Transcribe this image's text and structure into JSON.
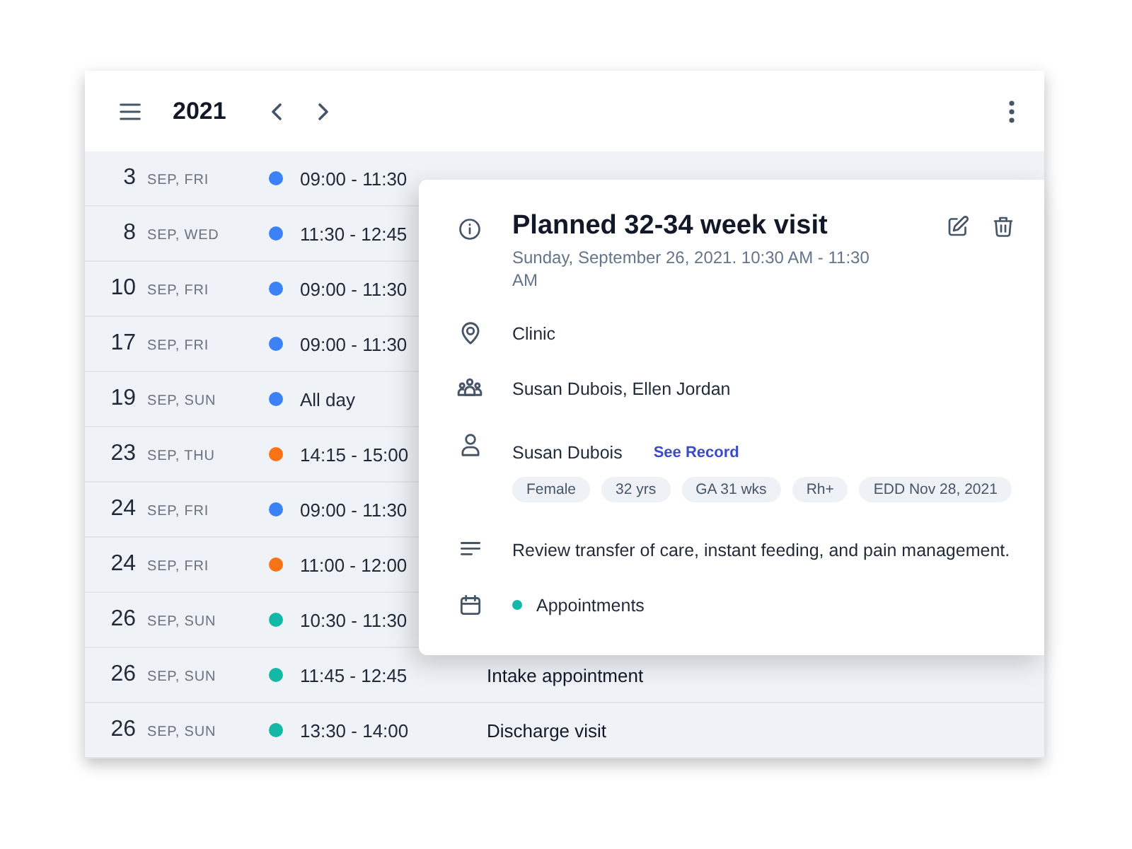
{
  "header": {
    "year": "2021"
  },
  "events": [
    {
      "day": "3",
      "date": "SEP, FRI",
      "color": "#3b82f6",
      "time": "09:00 - 11:30"
    },
    {
      "day": "8",
      "date": "SEP, WED",
      "color": "#3b82f6",
      "time": "11:30 - 12:45"
    },
    {
      "day": "10",
      "date": "SEP, FRI",
      "color": "#3b82f6",
      "time": "09:00 - 11:30"
    },
    {
      "day": "17",
      "date": "SEP, FRI",
      "color": "#3b82f6",
      "time": "09:00 - 11:30"
    },
    {
      "day": "19",
      "date": "SEP, SUN",
      "color": "#3b82f6",
      "time": "All day"
    },
    {
      "day": "23",
      "date": "SEP, THU",
      "color": "#f97316",
      "time": "14:15 - 15:00"
    },
    {
      "day": "24",
      "date": "SEP, FRI",
      "color": "#3b82f6",
      "time": "09:00 - 11:30"
    },
    {
      "day": "24",
      "date": "SEP, FRI",
      "color": "#f97316",
      "time": "11:00 - 12:00"
    },
    {
      "day": "26",
      "date": "SEP, SUN",
      "color": "#14b8a6",
      "time": "10:30 - 11:30"
    },
    {
      "day": "26",
      "date": "SEP, SUN",
      "color": "#14b8a6",
      "time": "11:45 - 12:45",
      "title": "Intake appointment"
    },
    {
      "day": "26",
      "date": "SEP, SUN",
      "color": "#14b8a6",
      "time": "13:30 - 14:00",
      "title": "Discharge visit"
    }
  ],
  "detail": {
    "title": "Planned 32-34 week visit",
    "when": "Sunday, September 26, 2021. 10:30 AM - 11:30 AM",
    "location": "Clinic",
    "attendees": "Susan Dubois, Ellen Jordan",
    "patient": {
      "name": "Susan Dubois",
      "link": "See Record",
      "tags": [
        "Female",
        "32 yrs",
        "GA 31 wks",
        "Rh+",
        "EDD Nov 28, 2021"
      ]
    },
    "notes": "Review transfer of care, instant feeding, and pain management.",
    "calendar": {
      "name": "Appointments",
      "color": "#14b8a6"
    }
  }
}
